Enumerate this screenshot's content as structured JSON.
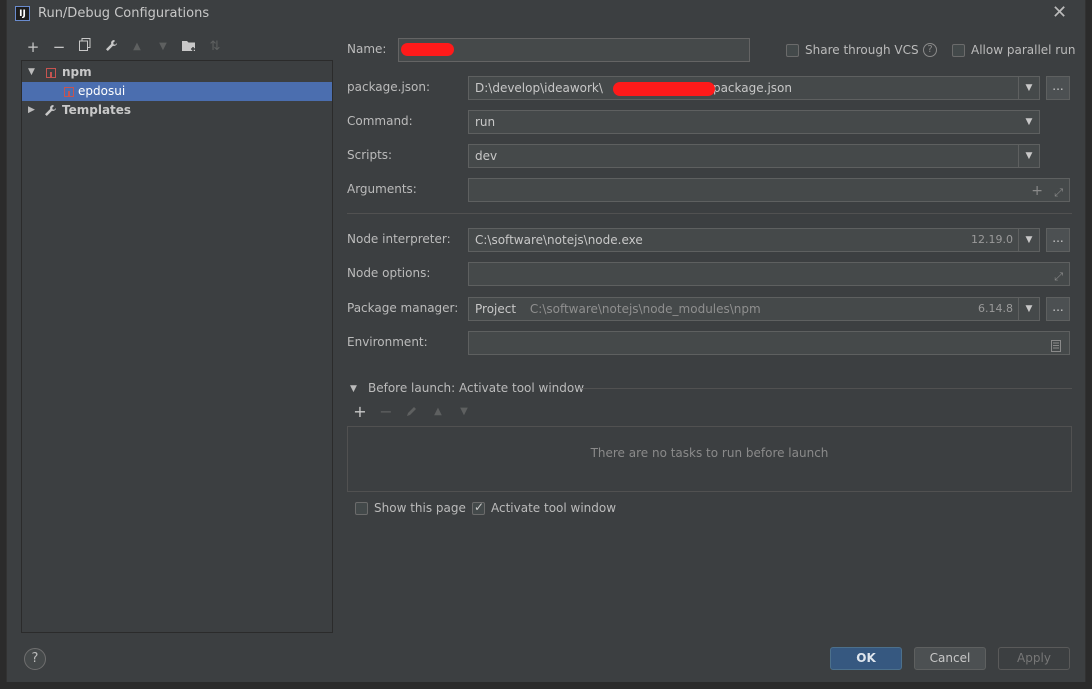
{
  "window": {
    "title": "Run/Debug Configurations",
    "app_icon": "IJ"
  },
  "toolbar": {
    "add": "+",
    "remove": "−",
    "copy": "⧉",
    "edit": "🔧",
    "up": "▲",
    "down": "▼",
    "folder": "📁",
    "sort": "⇅"
  },
  "tree": {
    "group": "npm",
    "config": "epdosui",
    "templates": "Templates"
  },
  "form": {
    "name_label": "Name:",
    "name_value": "",
    "share_label": "Share through VCS",
    "parallel_label": "Allow parallel run",
    "package_json_label": "package.json:",
    "package_json_prefix": "D:\\develop\\ideawork\\",
    "package_json_suffix": "\\package.json",
    "command_label": "Command:",
    "command_value": "run",
    "scripts_label": "Scripts:",
    "scripts_value": "dev",
    "arguments_label": "Arguments:",
    "arguments_value": "",
    "node_interpreter_label": "Node interpreter:",
    "node_interpreter_value": "C:\\software\\notejs\\node.exe",
    "node_version": "12.19.0",
    "node_options_label": "Node options:",
    "package_manager_label": "Package manager:",
    "package_manager_project": "Project",
    "package_manager_path": "C:\\software\\notejs\\node_modules\\npm",
    "package_manager_version": "6.14.8",
    "environment_label": "Environment:",
    "dots": "..."
  },
  "before_launch": {
    "title": "Before launch: Activate tool window",
    "empty_message": "There are no tasks to run before launch",
    "show_page_label": "Show this page",
    "activate_label": "Activate tool window"
  },
  "buttons": {
    "help": "?",
    "ok": "OK",
    "cancel": "Cancel",
    "apply": "Apply"
  },
  "colors": {
    "background": "#3c3f41",
    "selection": "#4b6eaf",
    "primary": "#365880"
  }
}
